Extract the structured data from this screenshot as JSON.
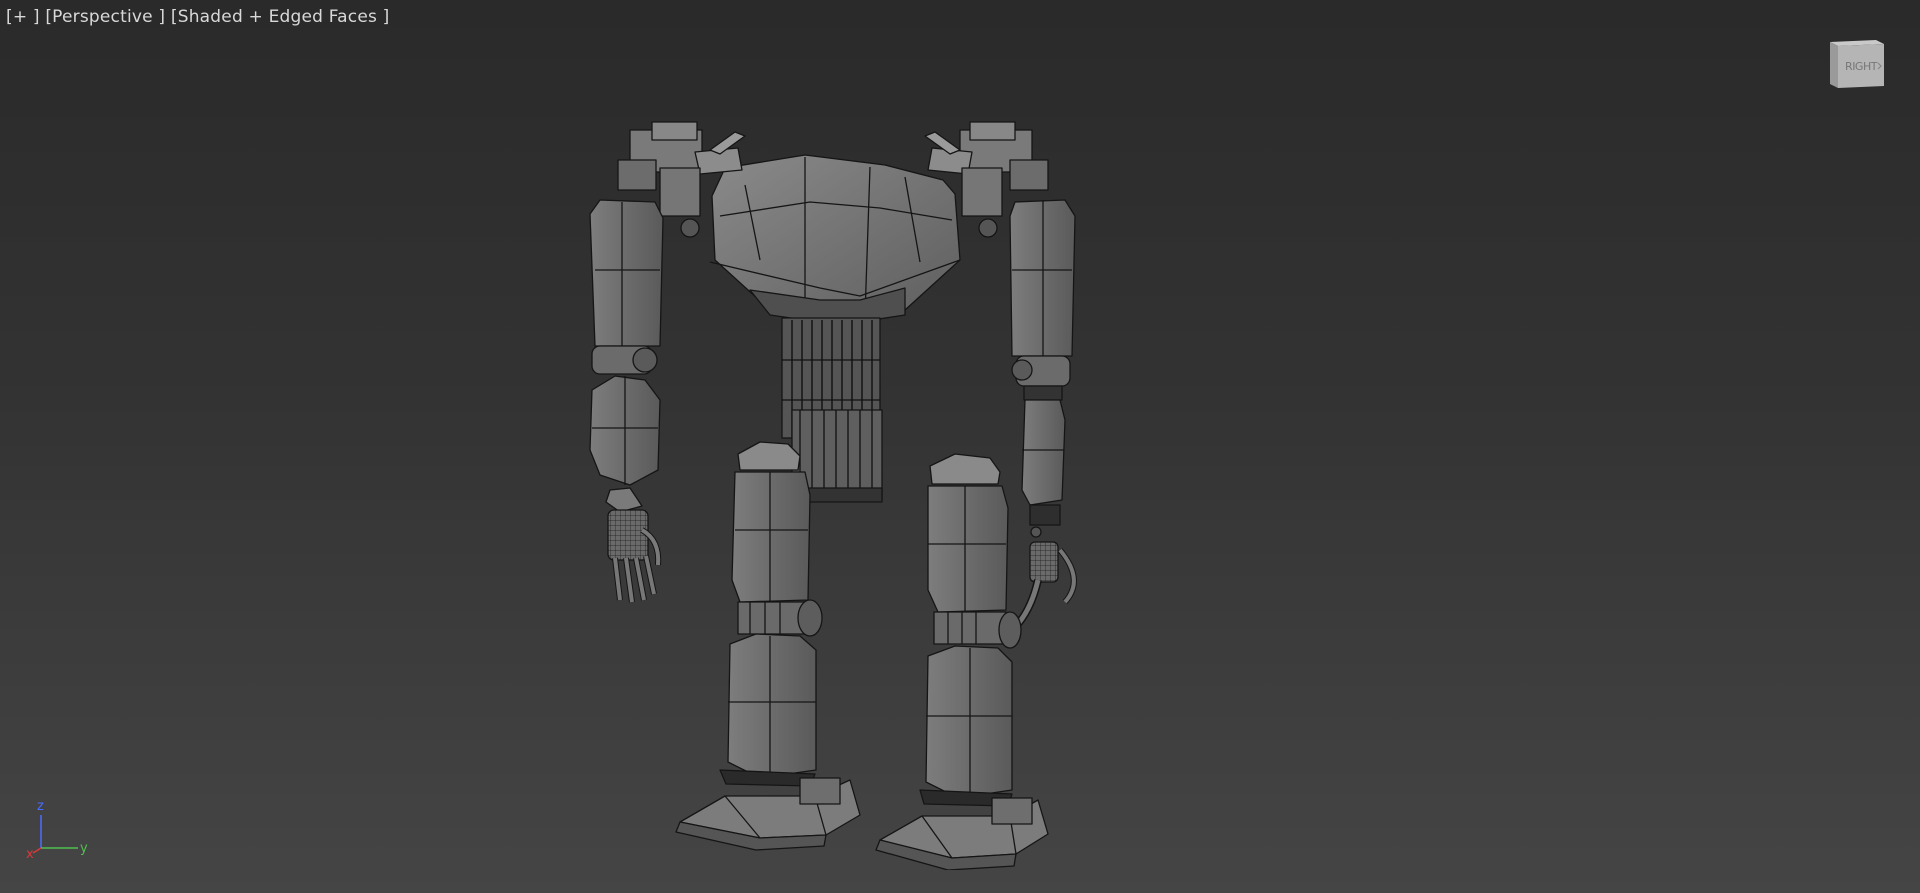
{
  "viewport": {
    "label_plus": "[+ ]",
    "label_view": "[Perspective ]",
    "label_shading": "[Shaded + Edged Faces ]"
  },
  "viewcube": {
    "face_label": "RIGHT"
  },
  "axis_tripod": {
    "z_label": "z",
    "y_label": "y",
    "x_label": "x",
    "x_color": "#d83a3a",
    "y_color": "#4fc04f",
    "z_color": "#4a6cff"
  }
}
